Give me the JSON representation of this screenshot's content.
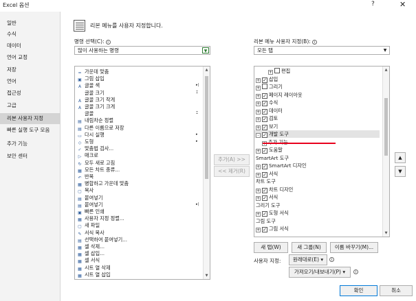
{
  "window": {
    "title": "Excel 옵션",
    "help": "?",
    "close": "✕"
  },
  "nav": {
    "items": [
      {
        "label": "일반",
        "active": false
      },
      {
        "label": "수식",
        "active": false
      },
      {
        "label": "데이터",
        "active": false
      },
      {
        "label": "언어 교정",
        "active": false
      },
      {
        "label": "저장",
        "active": false
      },
      {
        "label": "언어",
        "active": false
      },
      {
        "label": "접근성",
        "active": false
      },
      {
        "label": "고급",
        "active": false
      },
      {
        "label": "리본 사용자 지정",
        "active": true
      },
      {
        "label": "빠른 실행 도구 모음",
        "active": false
      },
      {
        "label": "추가 기능",
        "active": false
      },
      {
        "label": "보안 센터",
        "active": false
      }
    ]
  },
  "header": {
    "title": "리본 메뉴를 사용자 지정합니다."
  },
  "left": {
    "choose_label": "명령 선택(C):",
    "choose_value": "많이 사용하는 명령",
    "commands": [
      {
        "icon": "=",
        "label": "가운데 맞춤",
        "arrow": ""
      },
      {
        "icon": "▣",
        "label": "그림 삽입",
        "arrow": ""
      },
      {
        "icon": "A",
        "label": "글꼴 색",
        "arrow": "▸|"
      },
      {
        "icon": "",
        "label": "글꼴 크기",
        "arrow": "⌶"
      },
      {
        "icon": "A",
        "label": "글꼴 크기 작게",
        "arrow": ""
      },
      {
        "icon": "A",
        "label": "글꼴 크기 크게",
        "arrow": ""
      },
      {
        "icon": "",
        "label": "글꼴",
        "arrow": "⌶"
      },
      {
        "icon": "▤",
        "label": "내림차순 정렬",
        "arrow": ""
      },
      {
        "icon": "▤",
        "label": "다른 이름으로 저장",
        "arrow": ""
      },
      {
        "icon": "▭",
        "label": "다시 실행",
        "arrow": "▸"
      },
      {
        "icon": "◇",
        "label": "도형",
        "arrow": "▸"
      },
      {
        "icon": "✓",
        "label": "맞춤법 검사...",
        "arrow": ""
      },
      {
        "icon": "▷",
        "label": "매크로",
        "arrow": ""
      },
      {
        "icon": "↻",
        "label": "모두 새로 고침",
        "arrow": ""
      },
      {
        "icon": "▦",
        "label": "모든 차트 종류...",
        "arrow": ""
      },
      {
        "icon": "↶",
        "label": "반복",
        "arrow": ""
      },
      {
        "icon": "▦",
        "label": "병합하고 가운데 맞춤",
        "arrow": ""
      },
      {
        "icon": "▢",
        "label": "복사",
        "arrow": ""
      },
      {
        "icon": "▤",
        "label": "붙여넣기",
        "arrow": ""
      },
      {
        "icon": "▤",
        "label": "붙여넣기",
        "arrow": "▸|"
      },
      {
        "icon": "▣",
        "label": "빠른 인쇄",
        "arrow": ""
      },
      {
        "icon": "▦",
        "label": "사용자 지정 정렬...",
        "arrow": ""
      },
      {
        "icon": "▢",
        "label": "새 파일",
        "arrow": ""
      },
      {
        "icon": "✎",
        "label": "서식 복사",
        "arrow": ""
      },
      {
        "icon": "▤",
        "label": "선택하여 붙여넣기...",
        "arrow": ""
      },
      {
        "icon": "▦",
        "label": "셀 삭제...",
        "arrow": ""
      },
      {
        "icon": "▦",
        "label": "셀 삽입...",
        "arrow": ""
      },
      {
        "icon": "▦",
        "label": "셀 서식",
        "arrow": ""
      },
      {
        "icon": "▦",
        "label": "시트 열 삭제",
        "arrow": ""
      },
      {
        "icon": "▦",
        "label": "시트 열 삽입",
        "arrow": ""
      }
    ]
  },
  "middle": {
    "add": "추가(A) >>",
    "remove": "<< 제거(R)"
  },
  "right": {
    "customize_label": "리본 메뉴 사용자 지정(B):",
    "customize_value": "모든 탭",
    "tree": [
      {
        "indent": 2,
        "pm": "+",
        "cb": false,
        "label": "편집",
        "group": false,
        "sel": false
      },
      {
        "indent": 0,
        "pm": "+",
        "cb": true,
        "label": "삽입",
        "group": false,
        "sel": false
      },
      {
        "indent": 0,
        "pm": "+",
        "cb": false,
        "label": "그리기",
        "group": false,
        "sel": false
      },
      {
        "indent": 0,
        "pm": "+",
        "cb": true,
        "label": "페이지 레이아웃",
        "group": false,
        "sel": false
      },
      {
        "indent": 0,
        "pm": "+",
        "cb": true,
        "label": "수식",
        "group": false,
        "sel": false
      },
      {
        "indent": 0,
        "pm": "+",
        "cb": true,
        "label": "데이터",
        "group": false,
        "sel": false
      },
      {
        "indent": 0,
        "pm": "+",
        "cb": true,
        "label": "검토",
        "group": false,
        "sel": false
      },
      {
        "indent": 0,
        "pm": "+",
        "cb": true,
        "label": "보기",
        "group": false,
        "sel": false
      },
      {
        "indent": 0,
        "pm": "-",
        "cb": true,
        "label": "개발 도구",
        "group": false,
        "sel": true
      },
      {
        "indent": 1,
        "pm": "+",
        "cb": null,
        "label": "추가 기능",
        "group": false,
        "sel": false
      },
      {
        "indent": 0,
        "pm": "+",
        "cb": true,
        "label": "도움말",
        "group": false,
        "sel": false
      },
      {
        "indent": 0,
        "pm": "",
        "cb": null,
        "label": "SmartArt 도구",
        "group": true,
        "sel": false
      },
      {
        "indent": 0,
        "pm": "+",
        "cb": true,
        "label": "SmartArt 디자인",
        "group": false,
        "sel": false
      },
      {
        "indent": 0,
        "pm": "+",
        "cb": true,
        "label": "서식",
        "group": false,
        "sel": false
      },
      {
        "indent": 0,
        "pm": "",
        "cb": null,
        "label": "차트 도구",
        "group": true,
        "sel": false
      },
      {
        "indent": 0,
        "pm": "+",
        "cb": true,
        "label": "차트 디자인",
        "group": false,
        "sel": false
      },
      {
        "indent": 0,
        "pm": "+",
        "cb": true,
        "label": "서식",
        "group": false,
        "sel": false
      },
      {
        "indent": 0,
        "pm": "",
        "cb": null,
        "label": "그리기 도구",
        "group": true,
        "sel": false
      },
      {
        "indent": 0,
        "pm": "+",
        "cb": true,
        "label": "도형 서식",
        "group": false,
        "sel": false
      },
      {
        "indent": 0,
        "pm": "",
        "cb": null,
        "label": "그림 도구",
        "group": true,
        "sel": false
      },
      {
        "indent": 0,
        "pm": "+",
        "cb": true,
        "label": "그림 서식",
        "group": false,
        "sel": false
      }
    ],
    "new_tab": "새 탭(W)",
    "new_group": "새 그룹(N)",
    "rename": "이름 바꾸기(M)...",
    "custom_label": "사용자 지정:",
    "reset": "원래대로(E) ▾",
    "import_export": "가져오기/내보내기(P) ▾",
    "move_up": "▲",
    "move_down": "▼"
  },
  "footer": {
    "ok": "확인",
    "cancel": "취소"
  }
}
